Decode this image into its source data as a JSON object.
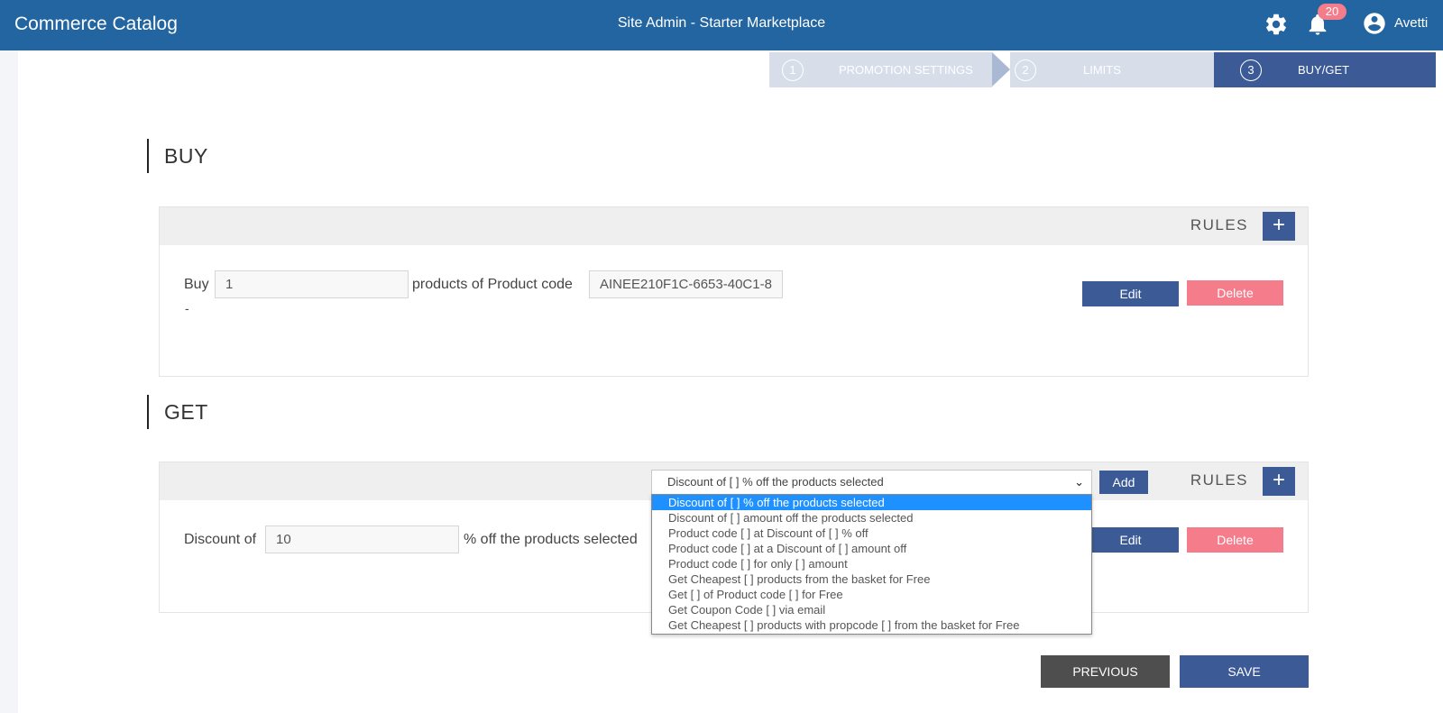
{
  "header": {
    "app_title": "Commerce Catalog",
    "site_title": "Site Admin - Starter Marketplace",
    "notification_count": "20",
    "user_name": "Avetti"
  },
  "steps": [
    {
      "number": "1",
      "label": "PROMOTION SETTINGS",
      "active": false
    },
    {
      "number": "2",
      "label": "LIMITS",
      "active": false
    },
    {
      "number": "3",
      "label": "BUY/GET",
      "active": true
    }
  ],
  "buy": {
    "title": "BUY",
    "rules_label": "RULES",
    "add_icon": "+",
    "rule": {
      "prefix": "Buy",
      "quantity": "1",
      "middle": "products of Product code",
      "product_code": "AINEE210F1C-6653-40C1-8",
      "note": "-",
      "edit_label": "Edit",
      "delete_label": "Delete"
    }
  },
  "get": {
    "title": "GET",
    "rules_label": "RULES",
    "add_icon": "+",
    "select_value": "Discount of [ ] % off the products selected",
    "add_label": "Add",
    "options": [
      "Discount of [ ] % off the products selected",
      "Discount of [ ] amount off the products selected",
      "Product code [ ] at Discount of [ ] % off",
      "Product code [ ] at a Discount of [ ] amount off",
      "Product code [ ] for only [ ] amount",
      "Get Cheapest [ ] products from the basket for Free",
      "Get [ ] of Product code [ ] for Free",
      "Get Coupon Code [ ] via email",
      "Get Cheapest [ ] products with propcode [ ] from the basket for Free"
    ],
    "rule": {
      "prefix": "Discount of",
      "value": "10",
      "suffix": "% off the products selected",
      "edit_label": "Edit",
      "delete_label": "Delete"
    }
  },
  "footer": {
    "previous_label": "PREVIOUS",
    "save_label": "SAVE"
  },
  "colors": {
    "header_bg": "#2265a0",
    "primary": "#3c5a96",
    "danger": "#f47c8b",
    "step_inactive": "#d7deea",
    "select_highlight": "#1e90ff"
  }
}
